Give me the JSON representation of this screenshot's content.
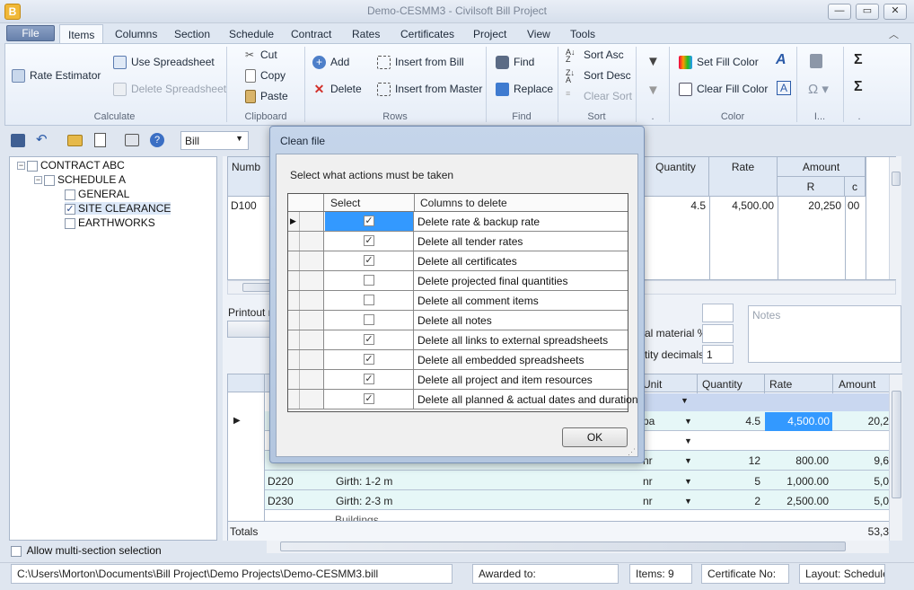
{
  "window": {
    "title": "Demo-CESMM3 - Civilsoft Bill Project",
    "app_icon": "B",
    "min": "—",
    "max": "▭",
    "close": "✕"
  },
  "menu": {
    "file": "File",
    "tabs": [
      "Items",
      "Columns",
      "Section",
      "Schedule",
      "Contract",
      "Rates",
      "Certificates",
      "Project",
      "View",
      "Tools"
    ],
    "active": "Items"
  },
  "ribbon": {
    "calculate": {
      "label": "Calculate",
      "rate_estimator": "Rate Estimator",
      "use_spreadsheet": "Use Spreadsheet",
      "delete_spreadsheet": "Delete Spreadsheet"
    },
    "clipboard": {
      "label": "Clipboard",
      "cut": "Cut",
      "copy": "Copy",
      "paste": "Paste"
    },
    "rows": {
      "label": "Rows",
      "add": "Add",
      "delete": "Delete",
      "insert_from_bill": "Insert from Bill",
      "insert_from_master": "Insert from Master"
    },
    "find": {
      "label": "Find",
      "find": "Find",
      "replace": "Replace"
    },
    "sort": {
      "label": "Sort",
      "asc": "Sort Asc",
      "desc": "Sort Desc",
      "clear": "Clear Sort"
    },
    "filter": {
      "label": "."
    },
    "color": {
      "label": "Color",
      "set_fill": "Set Fill Color",
      "clear_fill": "Clear Fill Color"
    },
    "insert": {
      "label": "I..."
    },
    "sum": {
      "label": "."
    }
  },
  "toolbar": {
    "bill_select": "Bill"
  },
  "tree": {
    "contract": "CONTRACT ABC",
    "schedule": "SCHEDULE A",
    "items": [
      {
        "label": "GENERAL",
        "checked": false
      },
      {
        "label": "SITE CLEARANCE",
        "checked": true
      },
      {
        "label": "EARTHWORKS",
        "checked": false
      }
    ],
    "multi_section": "Allow multi-section selection"
  },
  "top_grid": {
    "number_hdr": "Numb",
    "quantity_hdr": "Quantity",
    "rate_hdr": "Rate",
    "amount_hdr": "Amount",
    "r_hdr": "R",
    "c_hdr": "c",
    "row": {
      "number": "D100",
      "quantity": "4.5",
      "rate": "4,500.00",
      "amount_r": "20,250",
      "amount_c": "00"
    }
  },
  "middle": {
    "printout": "Printout n",
    "material": "al material %",
    "decimals_label": "tity decimals",
    "decimals_value": "1",
    "notes_placeholder": "Notes"
  },
  "lower_grid": {
    "headers": {
      "unit": "Unit",
      "quantity": "Quantity",
      "rate": "Rate",
      "amount": "Amount"
    },
    "rows": [
      {
        "code": "",
        "desc": "",
        "unit": "",
        "qty": "",
        "rate": "",
        "amount": ""
      },
      {
        "code": "",
        "desc": "",
        "unit": "pa",
        "qty": "4.5",
        "rate": "4,500.00",
        "amount": "20,2"
      },
      {
        "code": "",
        "desc": "",
        "unit": "",
        "qty": "",
        "rate": "",
        "amount": ""
      },
      {
        "code": "",
        "desc": "",
        "unit": "nr",
        "qty": "12",
        "rate": "800.00",
        "amount": "9,6"
      },
      {
        "code": "D220",
        "desc": "Girth: 1-2 m",
        "unit": "nr",
        "qty": "5",
        "rate": "1,000.00",
        "amount": "5,0"
      },
      {
        "code": "D230",
        "desc": "Girth: 2-3 m",
        "unit": "nr",
        "qty": "2",
        "rate": "2,500.00",
        "amount": "5,0"
      },
      {
        "code": "",
        "desc": "Buildings",
        "unit": "",
        "qty": "",
        "rate": "",
        "amount": ""
      }
    ],
    "totals_label": "Totals",
    "totals_value": "53,3"
  },
  "status": {
    "path": "C:\\Users\\Morton\\Documents\\Bill Project\\Demo Projects\\Demo-CESMM3.bill",
    "awarded": "Awarded to:",
    "items": "Items: 9",
    "certificate": "Certificate No:",
    "layout": "Layout: Schedule"
  },
  "dialog": {
    "title": "Clean file",
    "prompt": "Select what actions must be taken",
    "col_select": "Select",
    "col_delete": "Columns to delete",
    "rows": [
      {
        "label": "Delete rate & backup rate",
        "checked": true
      },
      {
        "label": "Delete all tender rates",
        "checked": true
      },
      {
        "label": "Delete all certificates",
        "checked": true
      },
      {
        "label": "Delete projected final quantities",
        "checked": false
      },
      {
        "label": "Delete all comment items",
        "checked": false
      },
      {
        "label": "Delete all notes",
        "checked": false
      },
      {
        "label": "Delete all links to external spreadsheets",
        "checked": true
      },
      {
        "label": "Delete all embedded spreadsheets",
        "checked": true
      },
      {
        "label": "Delete all project and item resources",
        "checked": true
      },
      {
        "label": "Delete all planned & actual dates and duration",
        "checked": true
      }
    ],
    "ok": "OK"
  },
  "colors": {
    "accent": "#6780ab",
    "selected_cell": "#3399ff",
    "row_tint": "#e6f7f7"
  }
}
